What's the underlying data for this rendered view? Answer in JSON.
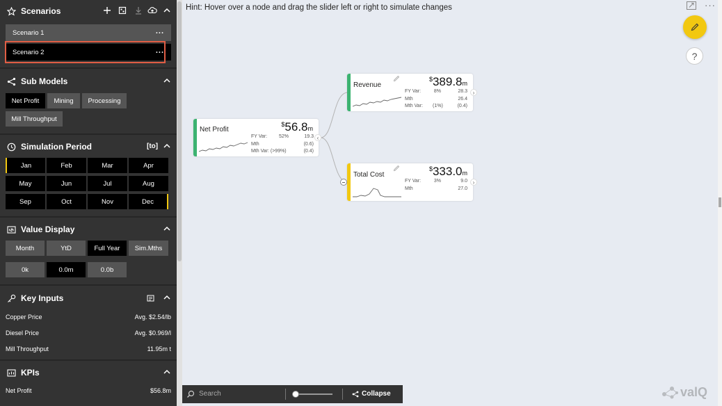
{
  "hint": "Hint: Hover over a node and drag the slider left or right to simulate changes",
  "scenarios": {
    "title": "Scenarios",
    "items": [
      {
        "label": "Scenario 1",
        "menu": "..."
      },
      {
        "label": "Scenario 2",
        "menu": "..."
      }
    ]
  },
  "sub_models": {
    "title": "Sub Models",
    "items": [
      "Net Profit",
      "Mining",
      "Processing",
      "Mill Throughput"
    ]
  },
  "simulation_period": {
    "title": "Simulation Period",
    "toggle": "[to]",
    "months": [
      "Jan",
      "Feb",
      "Mar",
      "Apr",
      "May",
      "Jun",
      "Jul",
      "Aug",
      "Sep",
      "Oct",
      "Nov",
      "Dec"
    ]
  },
  "value_display": {
    "title": "Value Display",
    "modes": [
      "Month",
      "YtD",
      "Full Year",
      "Sim.Mths"
    ],
    "formats": [
      "0k",
      "0.0m",
      "0.0b"
    ]
  },
  "key_inputs": {
    "title": "Key Inputs",
    "rows": [
      {
        "label": "Copper Price",
        "value": "Avg. $2.54/lb"
      },
      {
        "label": "Diesel Price",
        "value": "Avg. $0.969/l"
      },
      {
        "label": "Mill Throughput",
        "value": "11.95m t"
      }
    ]
  },
  "kpis": {
    "title": "KPIs",
    "rows": [
      {
        "label": "Net Profit",
        "value": "$56.8m"
      }
    ]
  },
  "nodes": {
    "net_profit": {
      "name": "Net Profit",
      "currency": "$",
      "value": "56.8",
      "unit": "m",
      "stats": [
        {
          "label": "FY Var:",
          "pct": "52%",
          "val": "19.3"
        },
        {
          "label": "Mth",
          "pct": "",
          "val": "(0.6)"
        },
        {
          "label": "Mth Var: (>99%)",
          "pct": "",
          "val": "(0.4)"
        }
      ],
      "color": "#3cb371"
    },
    "revenue": {
      "name": "Revenue",
      "currency": "$",
      "value": "389.8",
      "unit": "m",
      "stats": [
        {
          "label": "FY Var:",
          "pct": "8%",
          "val": "28.3"
        },
        {
          "label": "Mth",
          "pct": "",
          "val": "26.4"
        },
        {
          "label": "Mth Var:",
          "pct": "(1%)",
          "val": "(0.4)"
        }
      ],
      "color": "#3cb371"
    },
    "total_cost": {
      "name": "Total Cost",
      "currency": "$",
      "value": "333.0",
      "unit": "m",
      "stats": [
        {
          "label": "FY Var:",
          "pct": "3%",
          "val": "9.0"
        },
        {
          "label": "Mth",
          "pct": "",
          "val": "27.0"
        }
      ],
      "color": "#f2c811"
    }
  },
  "bottom_bar": {
    "search_placeholder": "Search",
    "collapse_label": "Collapse"
  },
  "brand": "valQ",
  "icons": {
    "add": "plus-icon",
    "import": "import-icon",
    "download": "download-icon",
    "upload": "cloud-upload-icon",
    "edit": "pencil-icon",
    "help": "question-icon",
    "focus": "expand-icon",
    "more": "more-options-icon"
  }
}
